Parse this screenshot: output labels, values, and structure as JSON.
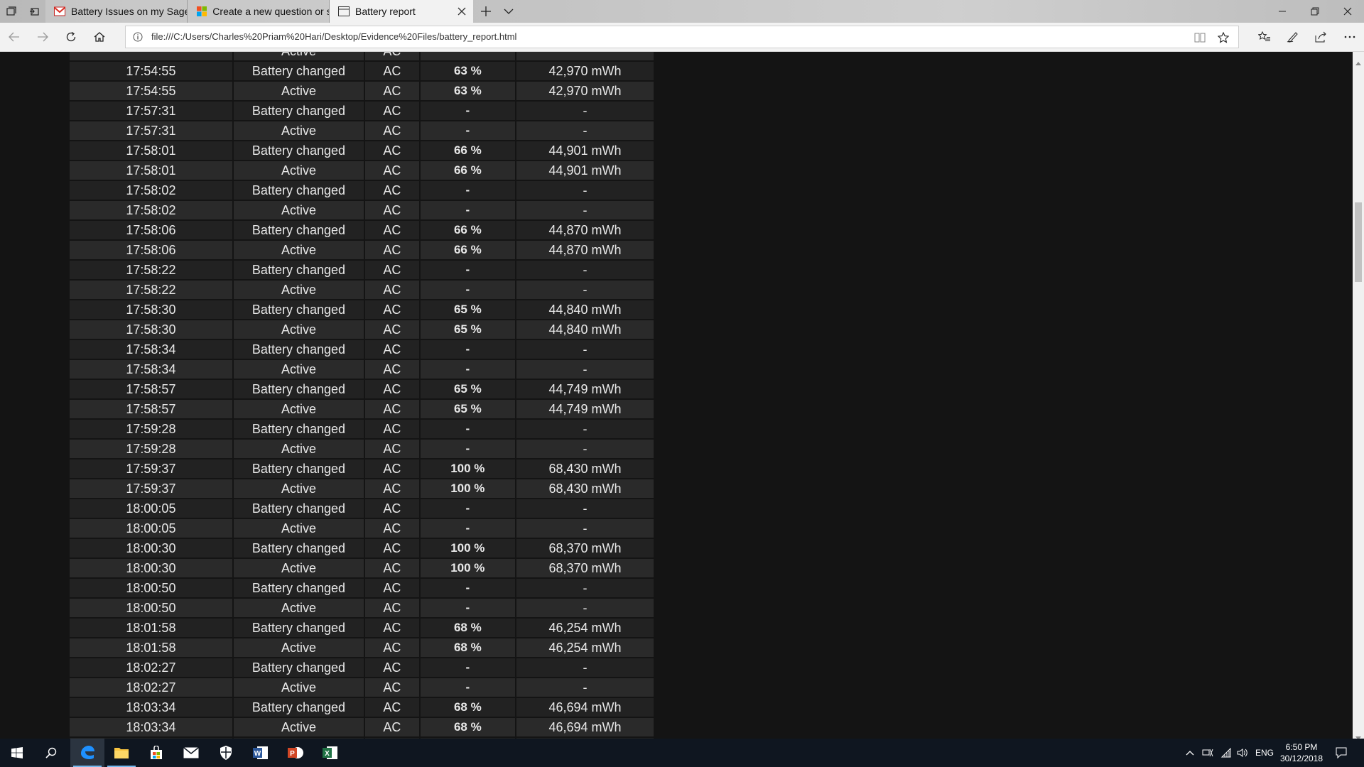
{
  "tabs": [
    {
      "label": "Battery Issues on my Sager",
      "icon": "gmail-icon",
      "active": false
    },
    {
      "label": "Create a new question or st",
      "icon": "microsoft-icon",
      "active": false
    },
    {
      "label": "Battery report",
      "icon": "page-icon",
      "active": true
    }
  ],
  "address": {
    "url": "file:///C:/Users/Charles%20Priam%20Hari/Desktop/Evidence%20Files/battery_report.html"
  },
  "table": {
    "partial_top": [
      "",
      "Active",
      "AC",
      "",
      ""
    ],
    "rows": [
      [
        "17:54:55",
        "Battery changed",
        "AC",
        "63 %",
        "42,970 mWh"
      ],
      [
        "17:54:55",
        "Active",
        "AC",
        "63 %",
        "42,970 mWh"
      ],
      [
        "17:57:31",
        "Battery changed",
        "AC",
        "-",
        "-"
      ],
      [
        "17:57:31",
        "Active",
        "AC",
        "-",
        "-"
      ],
      [
        "17:58:01",
        "Battery changed",
        "AC",
        "66 %",
        "44,901 mWh"
      ],
      [
        "17:58:01",
        "Active",
        "AC",
        "66 %",
        "44,901 mWh"
      ],
      [
        "17:58:02",
        "Battery changed",
        "AC",
        "-",
        "-"
      ],
      [
        "17:58:02",
        "Active",
        "AC",
        "-",
        "-"
      ],
      [
        "17:58:06",
        "Battery changed",
        "AC",
        "66 %",
        "44,870 mWh"
      ],
      [
        "17:58:06",
        "Active",
        "AC",
        "66 %",
        "44,870 mWh"
      ],
      [
        "17:58:22",
        "Battery changed",
        "AC",
        "-",
        "-"
      ],
      [
        "17:58:22",
        "Active",
        "AC",
        "-",
        "-"
      ],
      [
        "17:58:30",
        "Battery changed",
        "AC",
        "65 %",
        "44,840 mWh"
      ],
      [
        "17:58:30",
        "Active",
        "AC",
        "65 %",
        "44,840 mWh"
      ],
      [
        "17:58:34",
        "Battery changed",
        "AC",
        "-",
        "-"
      ],
      [
        "17:58:34",
        "Active",
        "AC",
        "-",
        "-"
      ],
      [
        "17:58:57",
        "Battery changed",
        "AC",
        "65 %",
        "44,749 mWh"
      ],
      [
        "17:58:57",
        "Active",
        "AC",
        "65 %",
        "44,749 mWh"
      ],
      [
        "17:59:28",
        "Battery changed",
        "AC",
        "-",
        "-"
      ],
      [
        "17:59:28",
        "Active",
        "AC",
        "-",
        "-"
      ],
      [
        "17:59:37",
        "Battery changed",
        "AC",
        "100 %",
        "68,430 mWh"
      ],
      [
        "17:59:37",
        "Active",
        "AC",
        "100 %",
        "68,430 mWh"
      ],
      [
        "18:00:05",
        "Battery changed",
        "AC",
        "-",
        "-"
      ],
      [
        "18:00:05",
        "Active",
        "AC",
        "-",
        "-"
      ],
      [
        "18:00:30",
        "Battery changed",
        "AC",
        "100 %",
        "68,370 mWh"
      ],
      [
        "18:00:30",
        "Active",
        "AC",
        "100 %",
        "68,370 mWh"
      ],
      [
        "18:00:50",
        "Battery changed",
        "AC",
        "-",
        "-"
      ],
      [
        "18:00:50",
        "Active",
        "AC",
        "-",
        "-"
      ],
      [
        "18:01:58",
        "Battery changed",
        "AC",
        "68 %",
        "46,254 mWh"
      ],
      [
        "18:01:58",
        "Active",
        "AC",
        "68 %",
        "46,254 mWh"
      ],
      [
        "18:02:27",
        "Battery changed",
        "AC",
        "-",
        "-"
      ],
      [
        "18:02:27",
        "Active",
        "AC",
        "-",
        "-"
      ],
      [
        "18:03:34",
        "Battery changed",
        "AC",
        "68 %",
        "46,694 mWh"
      ],
      [
        "18:03:34",
        "Active",
        "AC",
        "68 %",
        "46,694 mWh"
      ]
    ],
    "partial_bottom": [
      "",
      "",
      "AC",
      "",
      ""
    ]
  },
  "taskbar": {
    "apps": [
      "windows-start-icon",
      "search-icon",
      "edge-icon",
      "file-explorer-icon",
      "store-icon",
      "mail-icon",
      "security-icon",
      "word-icon",
      "powerpoint-icon",
      "excel-icon"
    ],
    "language": "ENG",
    "time": "6:50 PM",
    "date": "30/12/2018"
  },
  "colors": {
    "page_bg": "#141414",
    "row_odd": "#2a2a2a",
    "row_even": "#222222",
    "taskbar_bg": "#0f1620",
    "accent": "#0078d7"
  }
}
